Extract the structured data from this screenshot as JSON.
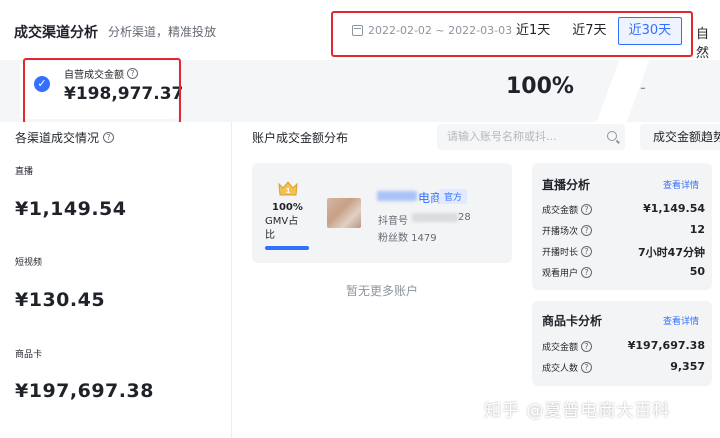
{
  "header": {
    "title": "成交渠道分析",
    "subtitle": "分析渠道，精准投放",
    "date_range": "2022-02-02 ~ 2022-03-03",
    "tabs": [
      "近1天",
      "近7天",
      "近30天"
    ],
    "active_tab": "近30天",
    "overflow_tab": "自然"
  },
  "kpi": {
    "label": "自营成交金额",
    "value": "¥198,977.37",
    "share": "100%",
    "placeholder": "-"
  },
  "channels": {
    "title": "各渠道成交情况",
    "items": [
      {
        "label": "直播",
        "value": "¥1,149.54"
      },
      {
        "label": "短视频",
        "value": "¥130.45"
      },
      {
        "label": "商品卡",
        "value": "¥197,697.38"
      }
    ]
  },
  "distribution": {
    "title": "账户成交金额分布",
    "search_placeholder": "请输入账号名称或抖...",
    "trend_button": "成交金额趋势"
  },
  "account": {
    "share": "100%",
    "share_label": "GMV占比",
    "name_suffix": "电商",
    "badge": "官方",
    "douyin_prefix": "抖音号",
    "douyin_suffix": "28",
    "fans": "粉丝数 1479",
    "no_more": "暂无更多账户"
  },
  "live": {
    "title": "直播分析",
    "link": "查看详情",
    "rows": [
      {
        "label": "成交金额",
        "value": "¥1,149.54"
      },
      {
        "label": "开播场次",
        "value": "12"
      },
      {
        "label": "开播时长",
        "value": "7小时47分钟"
      },
      {
        "label": "观看用户",
        "value": "50"
      }
    ]
  },
  "goods": {
    "title": "商品卡分析",
    "link": "查看详情",
    "rows": [
      {
        "label": "成交金额",
        "value": "¥197,697.38"
      },
      {
        "label": "成交人数",
        "value": "9,357"
      }
    ]
  },
  "watermark": "知乎 @夏普电商大百科",
  "colors": {
    "accent": "#3370ff",
    "highlight_box": "#e0282e",
    "card_bg": "#f3f4f6"
  }
}
